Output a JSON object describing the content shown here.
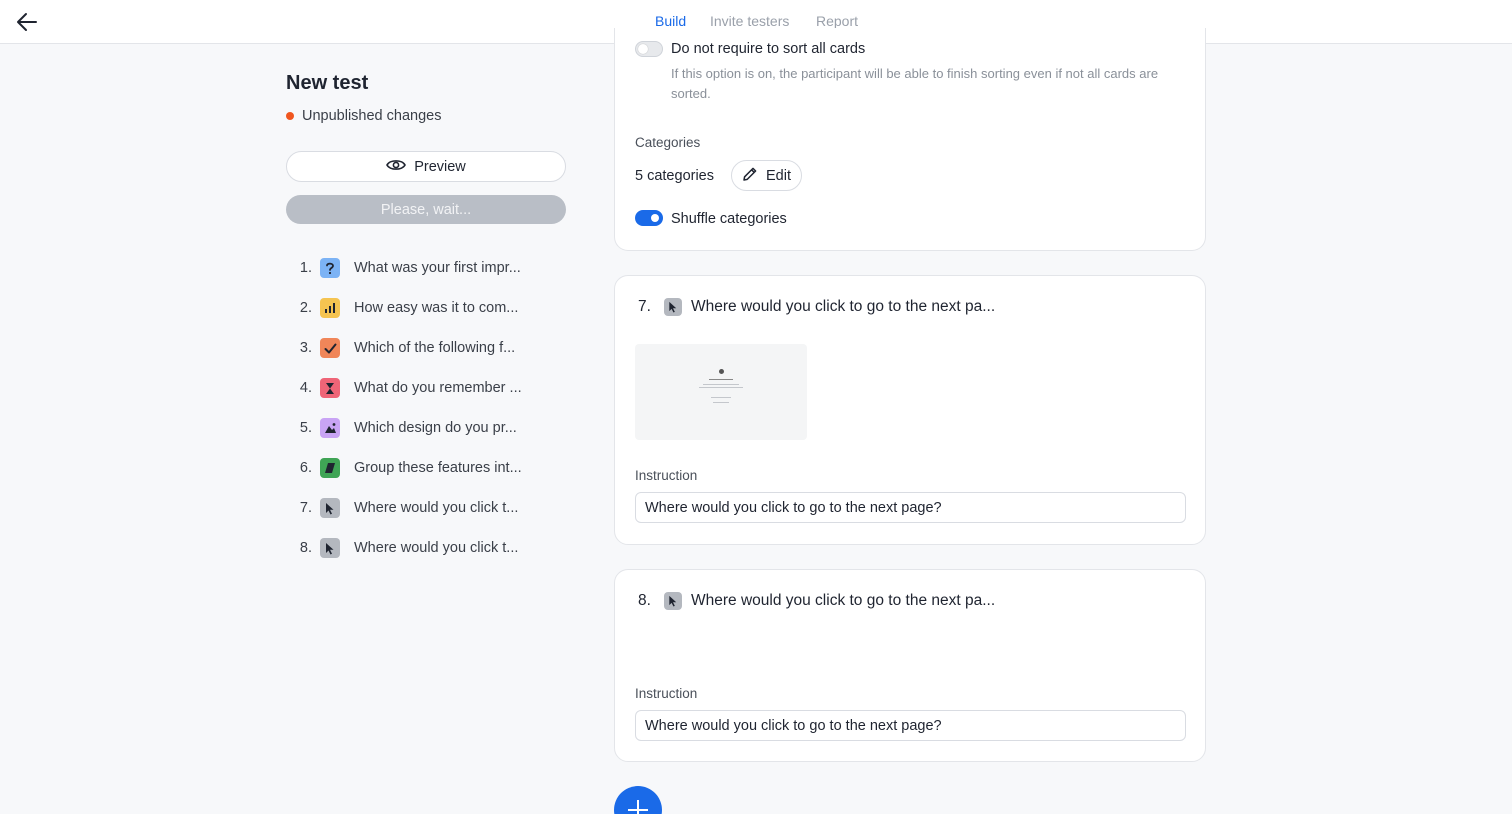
{
  "header": {
    "tabs": [
      {
        "label": "Build",
        "active": true
      },
      {
        "label": "Invite testers",
        "active": false
      },
      {
        "label": "Report",
        "active": false
      }
    ]
  },
  "sidebar": {
    "title": "New test",
    "status": "Unpublished changes",
    "preview_label": "Preview",
    "wait_label": "Please, wait...",
    "questions": [
      {
        "num": "1.",
        "text": "What was your first impr...",
        "icon": "question-icon",
        "color": "#7cb3f5"
      },
      {
        "num": "2.",
        "text": "How easy was it to com...",
        "icon": "bar-chart-icon",
        "color": "#f5c451"
      },
      {
        "num": "3.",
        "text": "Which of the following f...",
        "icon": "checkmark-icon",
        "color": "#f08659"
      },
      {
        "num": "4.",
        "text": "What do you remember ...",
        "icon": "hourglass-icon",
        "color": "#ef6577"
      },
      {
        "num": "5.",
        "text": "Which design do you pr...",
        "icon": "image-icon",
        "color": "#c9a4f5"
      },
      {
        "num": "6.",
        "text": "Group these features int...",
        "icon": "cards-icon",
        "color": "#3fa455"
      },
      {
        "num": "7.",
        "text": "Where would you click t...",
        "icon": "cursor-icon",
        "color": "#b4b8bf"
      },
      {
        "num": "8.",
        "text": "Where would you click t...",
        "icon": "cursor-icon",
        "color": "#b4b8bf"
      }
    ]
  },
  "card_sort": {
    "sort_all_label": "Do not require to sort all cards",
    "sort_all_help": "If this option is on, the participant will be able to finish sorting even if not all cards are sorted.",
    "sort_all_on": false,
    "categories_label": "Categories",
    "categories_count": "5 categories",
    "edit_label": "Edit",
    "shuffle_label": "Shuffle categories",
    "shuffle_on": true
  },
  "click_tests": [
    {
      "num": "7.",
      "title": "Where would you click to go to the next pa...",
      "instruction_label": "Instruction",
      "instruction_value": "Where would you click to go to the next page?",
      "has_image": true
    },
    {
      "num": "8.",
      "title": "Where would you click to go to the next pa...",
      "instruction_label": "Instruction",
      "instruction_value": "Where would you click to go to the next page?",
      "has_image": false
    }
  ],
  "colors": {
    "accent": "#1a6ae8",
    "status_dot": "#f0561f"
  }
}
